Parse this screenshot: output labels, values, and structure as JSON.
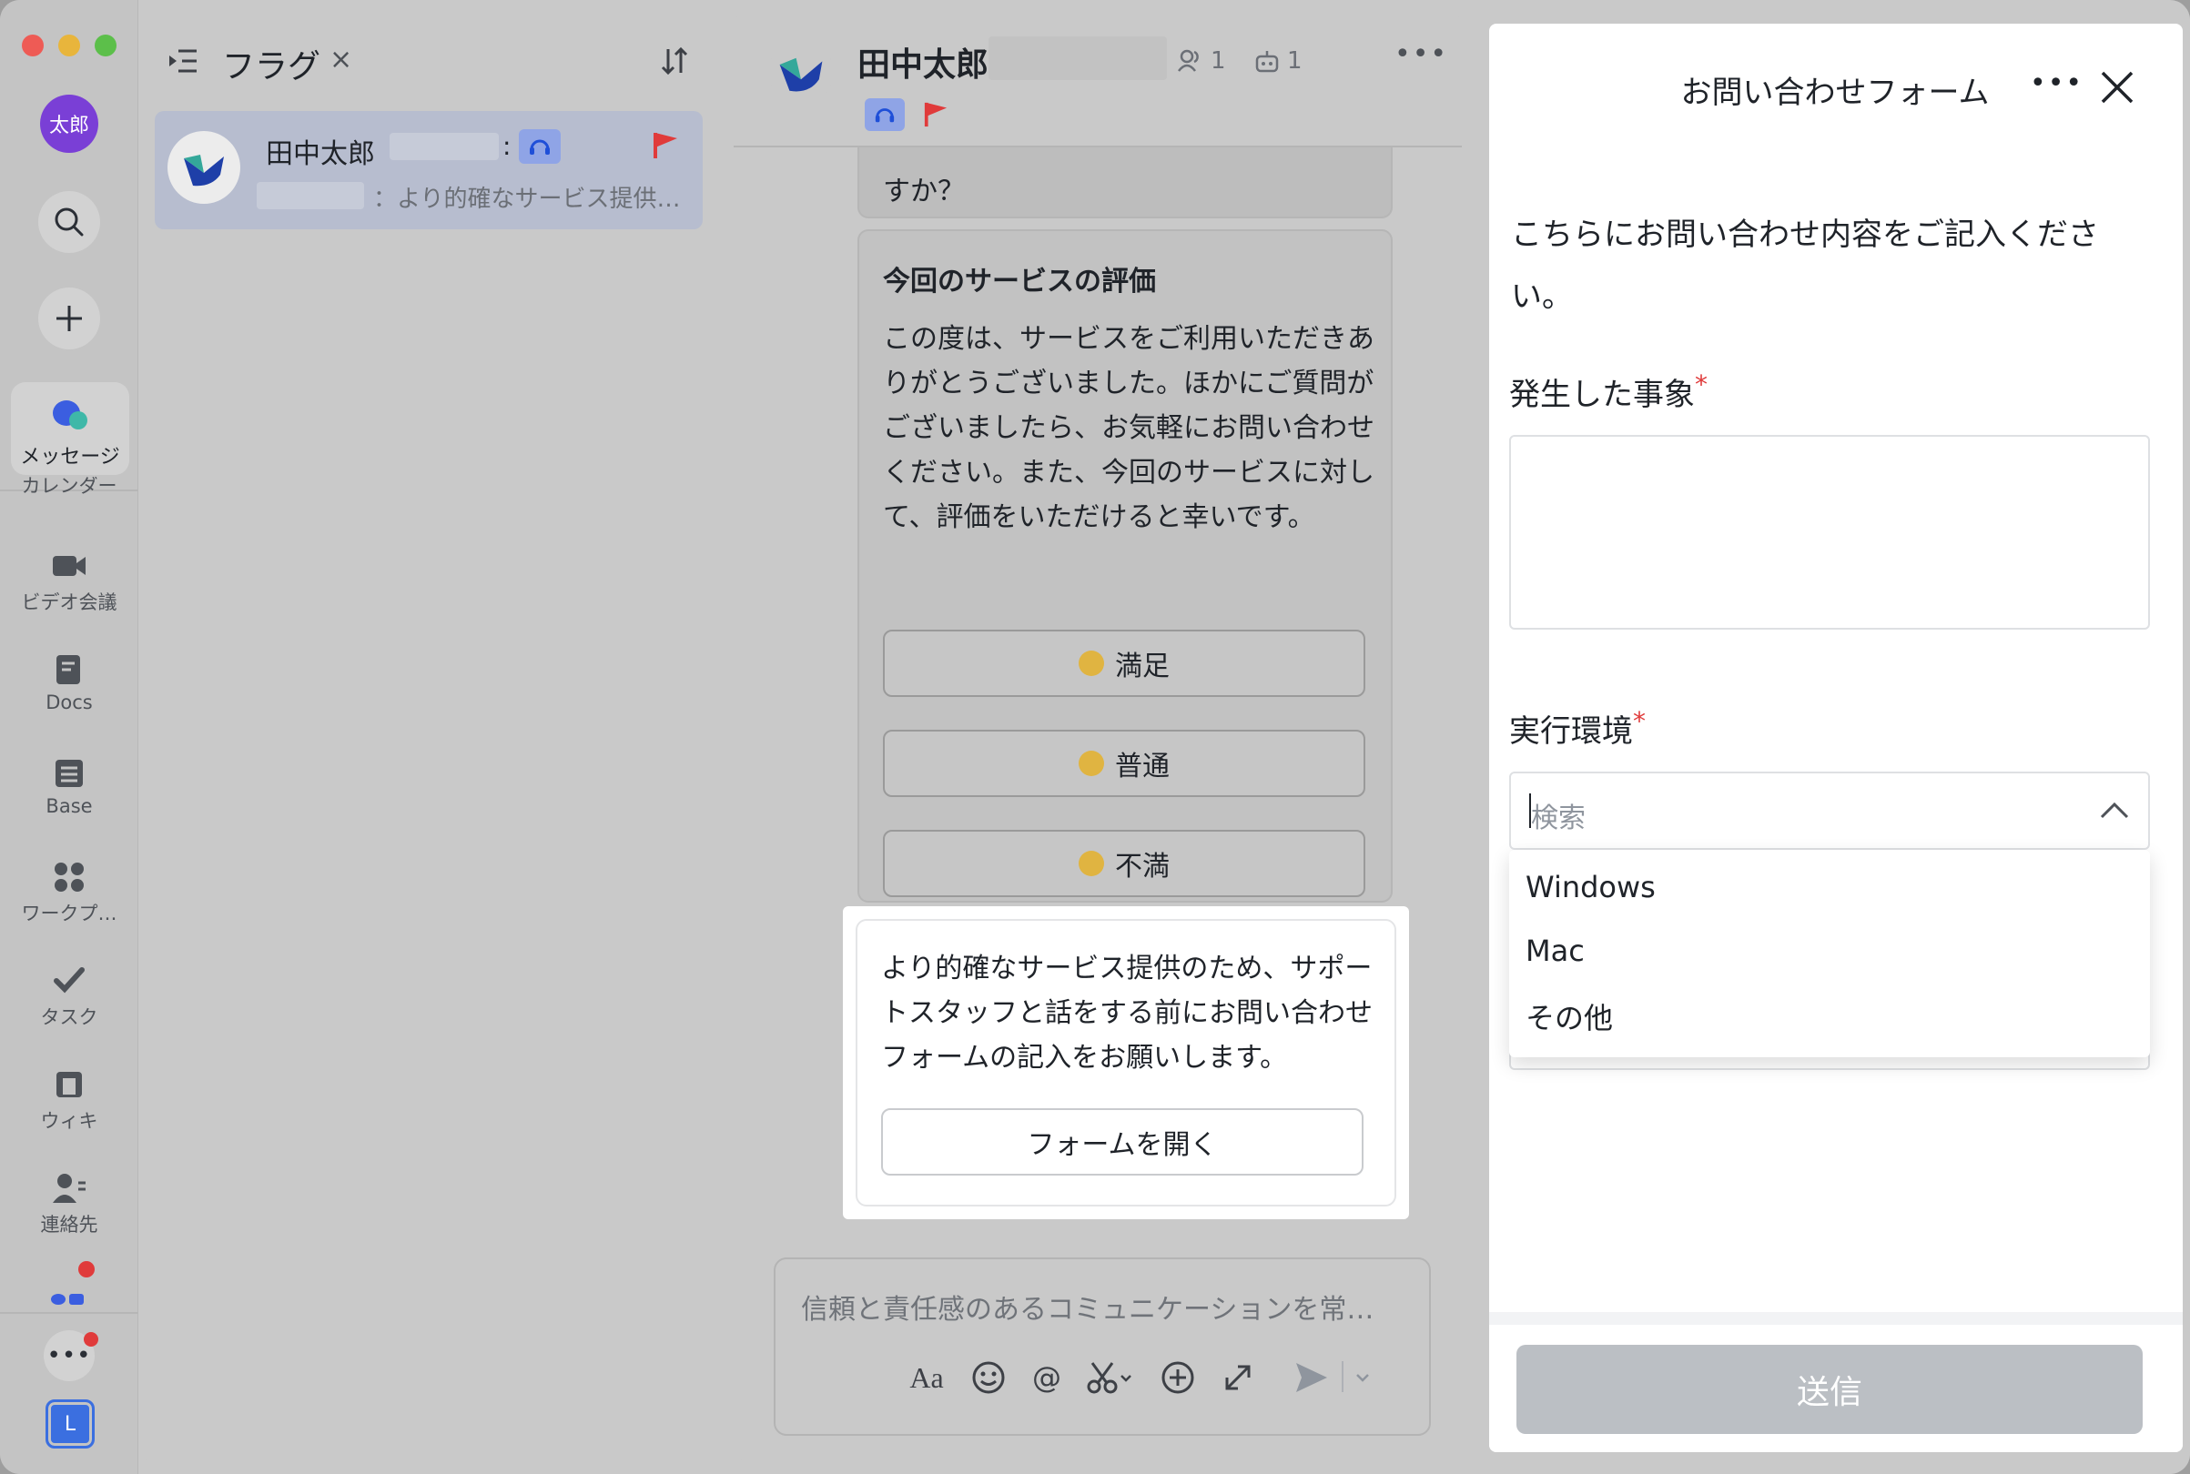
{
  "rail": {
    "avatar_text": "太郎",
    "active_label": "メッセージ",
    "items": [
      {
        "label": "カレンダー",
        "icon": "calendar-icon"
      },
      {
        "label": "ビデオ会議",
        "icon": "video-icon"
      },
      {
        "label": "Docs",
        "icon": "docs-icon"
      },
      {
        "label": "Base",
        "icon": "base-icon"
      },
      {
        "label": "ワークプ…",
        "icon": "workplace-icon"
      },
      {
        "label": "タスク",
        "icon": "task-icon"
      },
      {
        "label": "ウィキ",
        "icon": "wiki-icon"
      },
      {
        "label": "連絡先",
        "icon": "contacts-icon"
      }
    ],
    "bottom_avatar": "L"
  },
  "list": {
    "title": "フラグ",
    "close": "×",
    "conversation": {
      "name": "田中太郎",
      "preview": "：より的確なサービス提供…"
    }
  },
  "chat": {
    "name": "田中太郎",
    "member_count": "1",
    "bot_count": "1",
    "partial_text": "すか？",
    "rating_title": "今回のサービスの評価",
    "rating_text": "この度は、サービスをご利用いただきありがとうございました。ほかにご質問がございましたら、お気軽にお問い合わせください。また、今回のサービスに対して、評価をいただけると幸いです。",
    "options": [
      "満足",
      "普通",
      "不満"
    ],
    "form_message": "より的確なサービス提供のため、サポートスタッフと話をする前にお問い合わせフォームの記入をお願いします。",
    "form_button": "フォームを開く",
    "input_placeholder": "信頼と責任感のあるコミュニケーションを常…"
  },
  "form": {
    "title": "お問い合わせフォーム",
    "description": "こちらにお問い合わせ内容をご記入ください。",
    "field1_label": "発生した事象",
    "field2_label": "実行環境",
    "required_mark": "*",
    "search_placeholder": "検索",
    "options": [
      "Windows",
      "Mac",
      "その他"
    ],
    "submit": "送信"
  },
  "colors": {
    "accent_purple": "#7a3fd6",
    "flag_red": "#e03b3b",
    "brand_blue": "#3370ff"
  }
}
